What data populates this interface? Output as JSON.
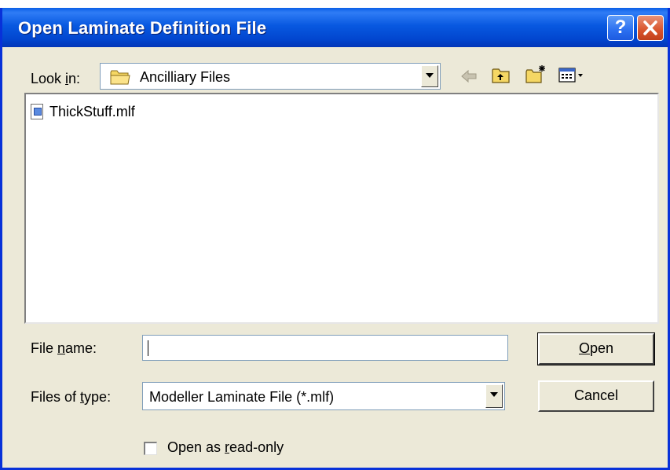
{
  "window": {
    "title": "Open Laminate Definition File",
    "help_glyph": "?",
    "close_glyph": "✕"
  },
  "lookin": {
    "label_pre": "Look ",
    "label_hot": "i",
    "label_post": "n:",
    "value": "Ancilliary Files",
    "icon": "folder-icon"
  },
  "toolbar": {
    "icons": [
      "back-arrow-icon",
      "up-folder-icon",
      "new-folder-icon",
      "view-menu-icon"
    ]
  },
  "files": [
    {
      "name": "ThickStuff.mlf",
      "icon": "document-icon"
    }
  ],
  "filename": {
    "label_pre": "File ",
    "label_hot": "n",
    "label_post": "ame:",
    "value": ""
  },
  "filetype": {
    "label_pre": "Files of ",
    "label_hot": "t",
    "label_post": "ype:",
    "value": "Modeller Laminate File (*.mlf)"
  },
  "buttons": {
    "open_hot": "O",
    "open_rest": "pen",
    "cancel": "Cancel"
  },
  "readonly": {
    "label_pre": "Open as ",
    "label_hot": "r",
    "label_post": "ead-only",
    "checked": false
  },
  "colors": {
    "titlebar": "#0a5fe6",
    "dialog_bg": "#ece9d8",
    "close_button": "#d9542c",
    "folder_yellow": "#f5d764"
  }
}
